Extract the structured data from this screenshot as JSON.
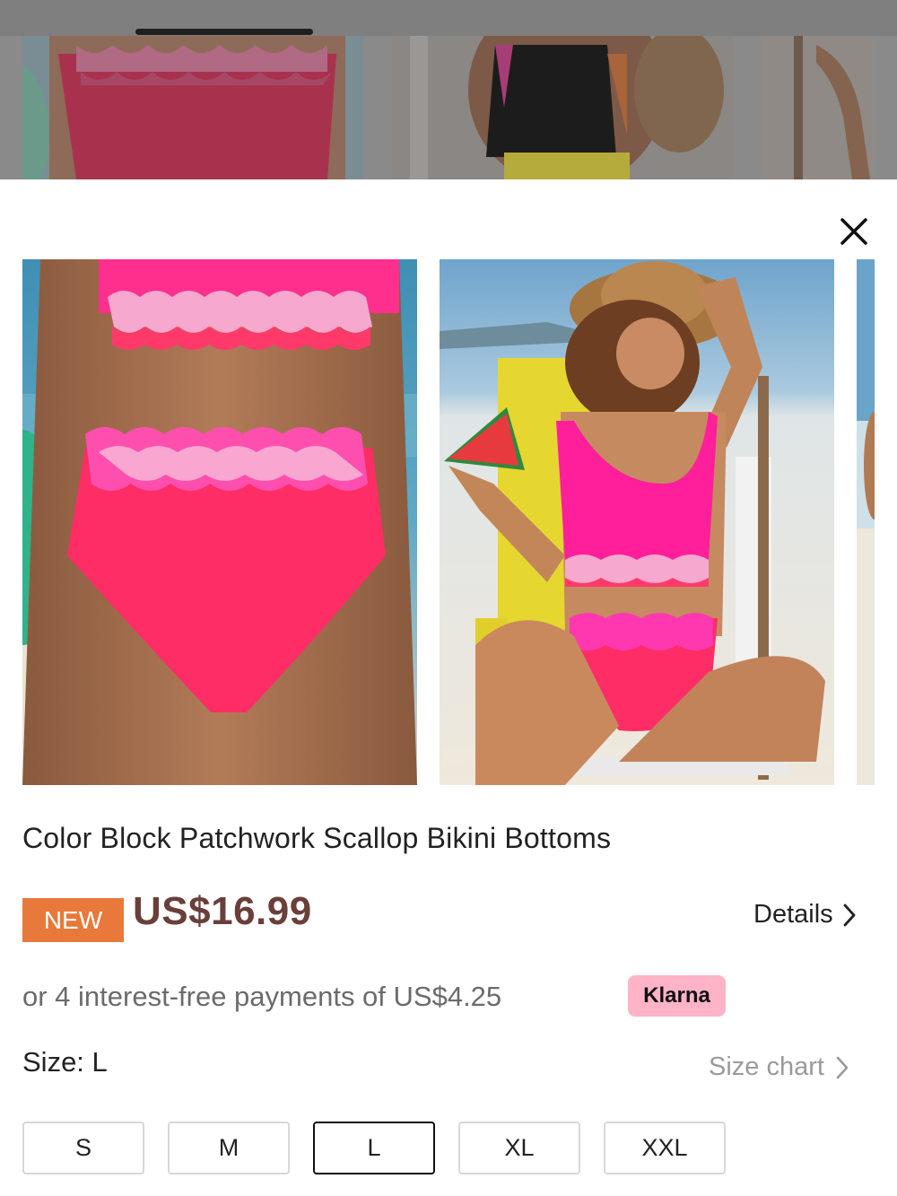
{
  "product": {
    "title": "Color Block Patchwork Scallop Bikini Bottoms",
    "badge": "NEW",
    "price": "US$16.99",
    "details_label": "Details",
    "payments_text": "or 4 interest-free payments of US$4.25",
    "payment_provider": "Klarna",
    "size_label": "Size: L",
    "size_chart_label": "Size chart",
    "sizes": [
      {
        "label": "S",
        "selected": false
      },
      {
        "label": "M",
        "selected": false
      },
      {
        "label": "L",
        "selected": true
      },
      {
        "label": "XL",
        "selected": false
      },
      {
        "label": "XXL",
        "selected": false
      }
    ]
  },
  "icons": {
    "close": "close-icon",
    "details_chevron": "chevron-right-icon",
    "size_chart_chevron": "chevron-right-icon"
  },
  "colors": {
    "new_badge": "#e8793a",
    "price": "#6a3f3a",
    "klarna_badge": "#ffb3c7",
    "selected_border": "#111111",
    "unselected_border": "#d8d8d8"
  }
}
